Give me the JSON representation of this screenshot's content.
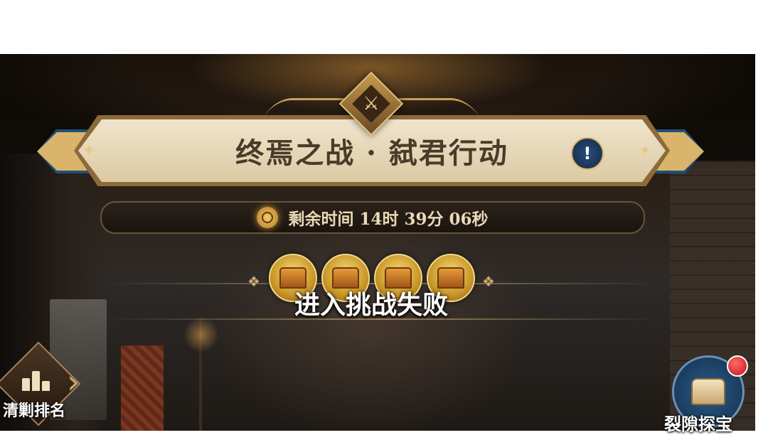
{
  "event": {
    "title": "终焉之战 · 弑君行动",
    "timer_text": "剩余时间 14时 39分 06秒"
  },
  "rewards": {
    "chests": [
      {
        "icon": "treasure-chest-icon"
      },
      {
        "icon": "treasure-chest-icon"
      },
      {
        "icon": "treasure-chest-icon"
      },
      {
        "icon": "treasure-chest-icon"
      }
    ]
  },
  "toast": {
    "message": "进入挑战失败"
  },
  "buttons": {
    "ranking_label": "清剿排名",
    "treasure_label": "裂隙探宝",
    "info_symbol": "!"
  },
  "colors": {
    "ribbon_blue": "#1f4f78",
    "gold": "#d9b46a",
    "plate": "#efe4cc",
    "notification_red": "#c41414"
  }
}
